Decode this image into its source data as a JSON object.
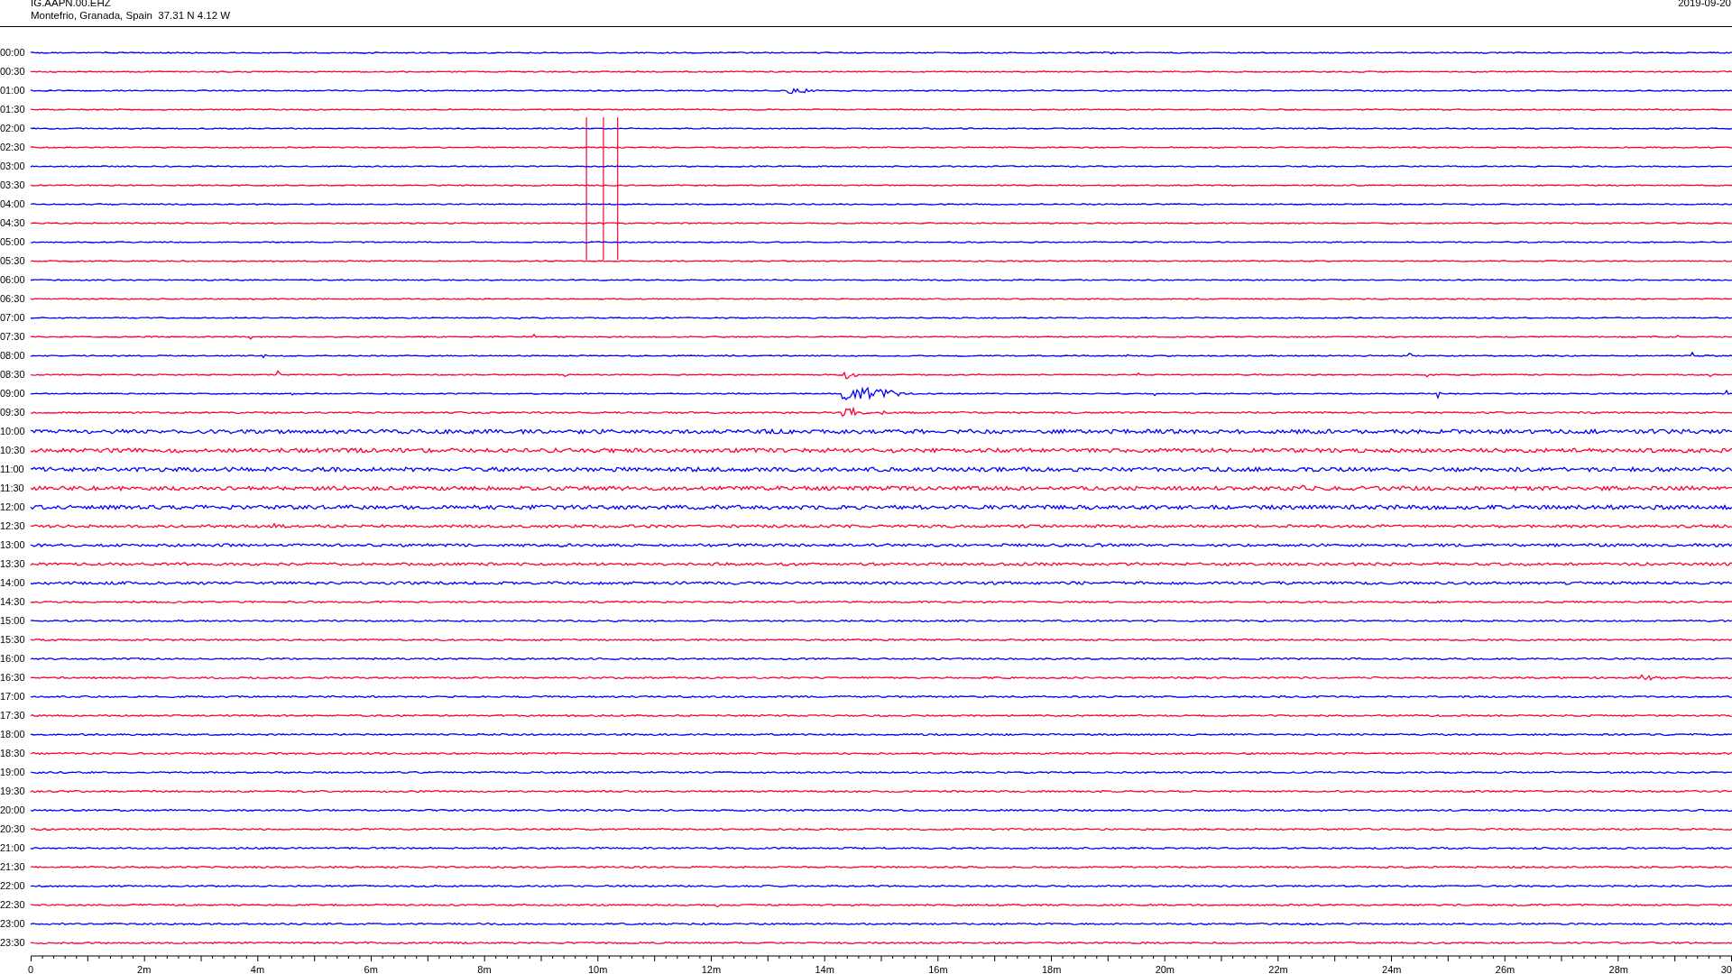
{
  "header": {
    "station": "IG.AAPN.00.EHZ",
    "location": "Montefrio, Granada, Spain  37.31 N 4.12 W",
    "date": "2019-09-20"
  },
  "rows": [
    {
      "time": "00:00",
      "color": "#0000ff"
    },
    {
      "time": "00:30",
      "color": "#ff0033"
    },
    {
      "time": "01:00",
      "color": "#0000ff"
    },
    {
      "time": "01:30",
      "color": "#ff0033"
    },
    {
      "time": "02:00",
      "color": "#0000ff"
    },
    {
      "time": "02:30",
      "color": "#ff0033"
    },
    {
      "time": "03:00",
      "color": "#0000ff"
    },
    {
      "time": "03:30",
      "color": "#ff0033"
    },
    {
      "time": "04:00",
      "color": "#0000ff"
    },
    {
      "time": "04:30",
      "color": "#ff0033"
    },
    {
      "time": "05:00",
      "color": "#0000ff"
    },
    {
      "time": "05:30",
      "color": "#ff0033"
    },
    {
      "time": "06:00",
      "color": "#0000ff"
    },
    {
      "time": "06:30",
      "color": "#ff0033"
    },
    {
      "time": "07:00",
      "color": "#0000ff"
    },
    {
      "time": "07:30",
      "color": "#ff0033"
    },
    {
      "time": "08:00",
      "color": "#0000ff"
    },
    {
      "time": "08:30",
      "color": "#ff0033"
    },
    {
      "time": "09:00",
      "color": "#0000ff"
    },
    {
      "time": "09:30",
      "color": "#ff0033"
    },
    {
      "time": "10:00",
      "color": "#0000ff"
    },
    {
      "time": "10:30",
      "color": "#ff0033"
    },
    {
      "time": "11:00",
      "color": "#0000ff"
    },
    {
      "time": "11:30",
      "color": "#ff0033"
    },
    {
      "time": "12:00",
      "color": "#0000ff"
    },
    {
      "time": "12:30",
      "color": "#ff0033"
    },
    {
      "time": "13:00",
      "color": "#0000ff"
    },
    {
      "time": "13:30",
      "color": "#ff0033"
    },
    {
      "time": "14:00",
      "color": "#0000ff"
    },
    {
      "time": "14:30",
      "color": "#ff0033"
    },
    {
      "time": "15:00",
      "color": "#0000ff"
    },
    {
      "time": "15:30",
      "color": "#ff0033"
    },
    {
      "time": "16:00",
      "color": "#0000ff"
    },
    {
      "time": "16:30",
      "color": "#ff0033"
    },
    {
      "time": "17:00",
      "color": "#0000ff"
    },
    {
      "time": "17:30",
      "color": "#ff0033"
    },
    {
      "time": "18:00",
      "color": "#0000ff"
    },
    {
      "time": "18:30",
      "color": "#ff0033"
    },
    {
      "time": "19:00",
      "color": "#0000ff"
    },
    {
      "time": "19:30",
      "color": "#ff0033"
    },
    {
      "time": "20:00",
      "color": "#0000ff"
    },
    {
      "time": "20:30",
      "color": "#ff0033"
    },
    {
      "time": "21:00",
      "color": "#0000ff"
    },
    {
      "time": "21:30",
      "color": "#ff0033"
    },
    {
      "time": "22:00",
      "color": "#0000ff"
    },
    {
      "time": "22:30",
      "color": "#ff0033"
    },
    {
      "time": "23:00",
      "color": "#0000ff"
    },
    {
      "time": "23:30",
      "color": "#ff0033"
    }
  ],
  "x_axis": {
    "labels": [
      "0",
      "2m",
      "4m",
      "6m",
      "8m",
      "10m",
      "12m",
      "14m",
      "16m",
      "18m",
      "20m",
      "22m",
      "24m",
      "26m",
      "28m",
      "30"
    ]
  }
}
